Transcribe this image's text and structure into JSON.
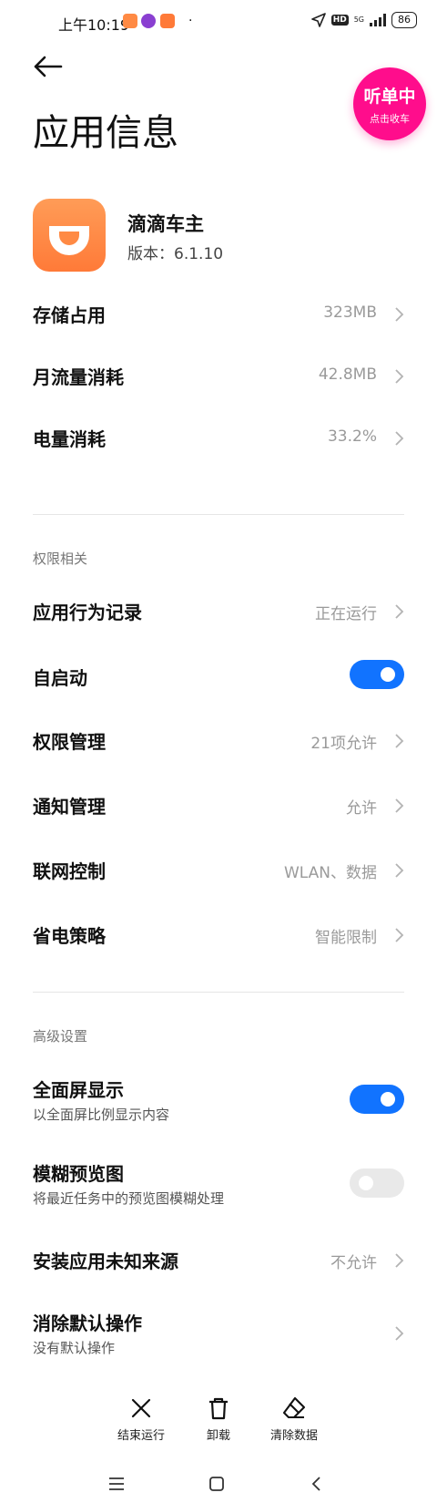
{
  "status_bar": {
    "time": "上午10:19",
    "dot": "·",
    "network": "5G",
    "hd": "HD",
    "battery": "86"
  },
  "floating_badge": {
    "main": "听单中",
    "sub": "点击收车",
    "color": "#ff0d8c"
  },
  "header": {
    "title": "应用信息"
  },
  "app": {
    "name": "滴滴车主",
    "version": "版本：6.1.10",
    "icon_color": "#ff8a44"
  },
  "usage": [
    {
      "label": "存储占用",
      "value": "323MB"
    },
    {
      "label": "月流量消耗",
      "value": "42.8MB"
    },
    {
      "label": "电量消耗",
      "value": "33.2%"
    }
  ],
  "permissions": {
    "section_title": "权限相关",
    "behavior_record": {
      "label": "应用行为记录",
      "value": "正在运行"
    },
    "autostart": {
      "label": "自启动",
      "on": true
    },
    "permission_manage": {
      "label": "权限管理",
      "value": "21项允许"
    },
    "notification_manage": {
      "label": "通知管理",
      "value": "允许"
    },
    "network_control": {
      "label": "联网控制",
      "value": "WLAN、数据"
    },
    "power_policy": {
      "label": "省电策略",
      "value": "智能限制"
    }
  },
  "advanced": {
    "section_title": "高级设置",
    "fullscreen": {
      "label": "全面屏显示",
      "sub": "以全面屏比例显示内容",
      "on": true
    },
    "blur_preview": {
      "label": "模糊预览图",
      "sub": "将最近任务中的预览图模糊处理",
      "on": false
    },
    "unknown_sources": {
      "label": "安装应用未知来源",
      "value": "不允许"
    },
    "clear_defaults": {
      "label": "消除默认操作",
      "sub": "没有默认操作"
    }
  },
  "actions": {
    "force_stop": "结束运行",
    "uninstall": "卸载",
    "clear_data": "清除数据"
  },
  "colors": {
    "toggle_on": "#1173ff",
    "toggle_off": "#e9e9e9",
    "secondary_text": "#9a9a9a"
  }
}
